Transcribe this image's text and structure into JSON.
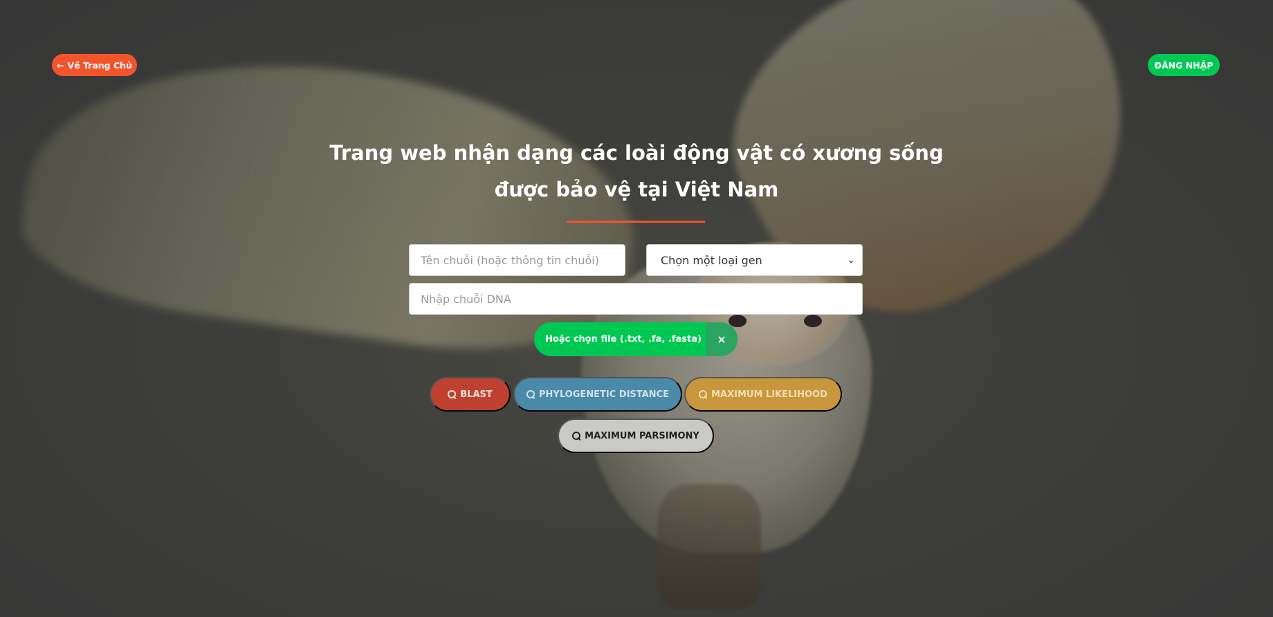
{
  "nav": {
    "home_label": "Về Trang Chủ",
    "home_icon": "arrow-left-icon",
    "login_label": "ĐĂNG NHẬP"
  },
  "header": {
    "title_line1": "Trang web nhận dạng các loài động vật có xương sống",
    "title_line2": "được bảo vệ tại Việt Nam"
  },
  "form": {
    "name_placeholder": "Tên chuỗi (hoặc thông tin chuỗi)",
    "gene_select_value": "Chọn một loại gen",
    "dna_placeholder": "Nhập chuỗi DNA",
    "file_label": "Hoặc chọn file (.txt, .fa, .fasta)",
    "file_clear": "×"
  },
  "actions": {
    "blast": "BLAST",
    "phylo": "PHYLOGENETIC DISTANCE",
    "ml": "MAXIMUM LIKELIHOOD",
    "mp": "MAXIMUM PARSIMONY"
  },
  "colors": {
    "accent_orange": "#f2542d",
    "accent_green": "#00c853",
    "blast": "#c0412f",
    "phylo": "#4a8aa8",
    "ml": "#c8973d",
    "mp": "#c9c9c6"
  }
}
